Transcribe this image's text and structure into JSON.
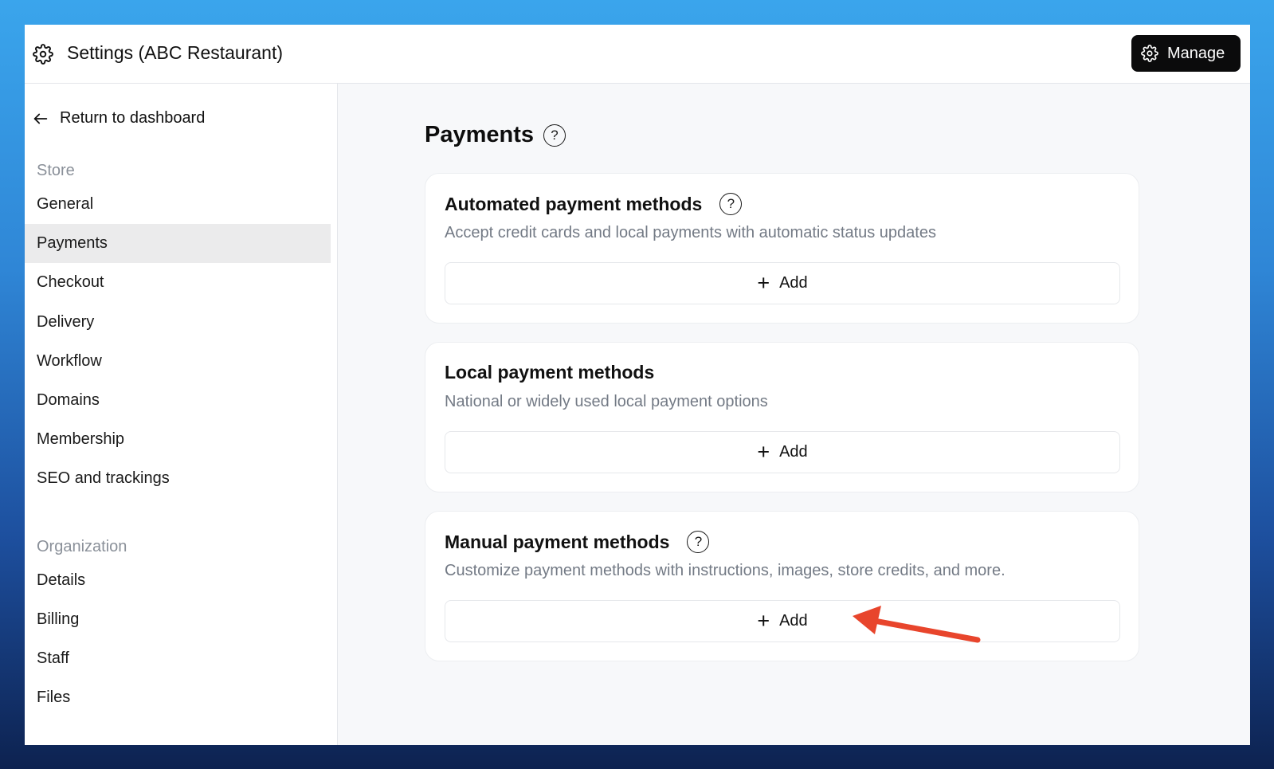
{
  "header": {
    "title": "Settings (ABC Restaurant)",
    "manage_label": "Manage"
  },
  "sidebar": {
    "back_label": "Return to dashboard",
    "store_section": "Store",
    "store_items": [
      "General",
      "Payments",
      "Checkout",
      "Delivery",
      "Workflow",
      "Domains",
      "Membership",
      "SEO and trackings"
    ],
    "active_item": "Payments",
    "org_section": "Organization",
    "org_items": [
      "Details",
      "Billing",
      "Staff",
      "Files"
    ]
  },
  "main": {
    "title": "Payments",
    "help_glyph": "?",
    "cards": [
      {
        "title": "Automated payment methods",
        "description": "Accept credit cards and local payments with automatic status updates",
        "add_label": "Add",
        "has_help": true
      },
      {
        "title": "Local payment methods",
        "description": "National or widely used local payment options",
        "add_label": "Add",
        "has_help": false
      },
      {
        "title": "Manual payment methods",
        "description": "Customize payment methods with instructions, images, store credits, and more.",
        "add_label": "Add",
        "has_help": true
      }
    ]
  },
  "annotation": {
    "arrow_color": "#e8452c"
  },
  "colors": {
    "manage_bg": "#0b0b0c",
    "active_nav_bg": "#ebebec",
    "muted_text": "#737a85"
  }
}
